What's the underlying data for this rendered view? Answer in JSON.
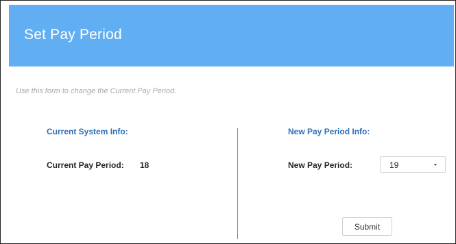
{
  "header": {
    "title": "Set Pay Period"
  },
  "intro_text": "Use this form to change the Current Pay Period.",
  "current_system": {
    "heading": "Current System Info:",
    "pay_period_label": "Current Pay Period:",
    "pay_period_value": "18"
  },
  "new_pay_period": {
    "heading": "New Pay Period Info:",
    "pay_period_label": "New Pay Period:",
    "selected_value": "19"
  },
  "actions": {
    "submit_label": "Submit"
  },
  "colors": {
    "header_bg": "#62aef2",
    "heading_text": "#2e6fb8",
    "divider": "#5a8fc8"
  }
}
